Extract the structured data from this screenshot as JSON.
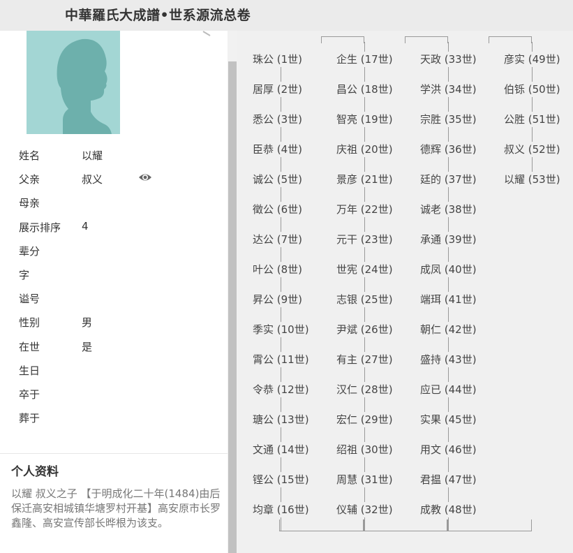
{
  "header": {
    "title": "中華羅氏大成譜•世系源流总卷"
  },
  "profile": {
    "fields": [
      {
        "label": "姓名",
        "value": "以耀"
      },
      {
        "label": "父亲",
        "value": "叔义"
      },
      {
        "label": "母亲",
        "value": ""
      },
      {
        "label": "展示排序",
        "value": "4"
      },
      {
        "label": "辈分",
        "value": ""
      },
      {
        "label": "字",
        "value": ""
      },
      {
        "label": "谥号",
        "value": ""
      },
      {
        "label": "性别",
        "value": "男"
      },
      {
        "label": "在世",
        "value": "是"
      },
      {
        "label": "生日",
        "value": ""
      },
      {
        "label": "卒于",
        "value": ""
      },
      {
        "label": "葬于",
        "value": ""
      }
    ],
    "bio_title": "个人资料",
    "bio_text": "以耀  叔义之子 【于明成化二十年(1484)由后保迁高安相城镇华塘罗村开基】高安原市长罗鑫隆、高安宣传部长晔根为该支。"
  },
  "colors": {
    "avatar_bg": "#a3d6d4",
    "avatar_silhouette": "#6db0ac"
  },
  "icons": {
    "eye": "eye-icon",
    "avatar": "person-silhouette-icon"
  },
  "tree": {
    "columns": [
      [
        "珠公 (1世)",
        "居厚 (2世)",
        "悉公 (3世)",
        "臣恭 (4世)",
        "诚公 (5世)",
        "徵公 (6世)",
        "达公 (7世)",
        "叶公 (8世)",
        "昇公 (9世)",
        "季实 (10世)",
        "霄公 (11世)",
        "令恭 (12世)",
        "瑭公 (13世)",
        "文通 (14世)",
        "铿公 (15世)",
        "均章 (16世)"
      ],
      [
        "企生 (17世)",
        "昌公 (18世)",
        "智亮 (19世)",
        "庆祖 (20世)",
        "景彦 (21世)",
        "万年 (22世)",
        "元干 (23世)",
        "世宪 (24世)",
        "志银 (25世)",
        "尹斌 (26世)",
        "有主 (27世)",
        "汉仁 (28世)",
        "宏仁 (29世)",
        "绍祖 (30世)",
        "周慧 (31世)",
        "仪辅 (32世)"
      ],
      [
        "天政 (33世)",
        "学洪 (34世)",
        "宗胜 (35世)",
        "德辉 (36世)",
        "廷的 (37世)",
        "诚老 (38世)",
        "承通 (39世)",
        "成凤 (40世)",
        "端珥 (41世)",
        "朝仁 (42世)",
        "盛持 (43世)",
        "应已 (44世)",
        "实果 (45世)",
        "用文 (46世)",
        "君揾 (47世)",
        "成教 (48世)"
      ],
      [
        "彦实 (49世)",
        "伯铄 (50世)",
        "公胜 (51世)",
        "叔义 (52世)",
        "以耀 (53世)"
      ]
    ]
  }
}
